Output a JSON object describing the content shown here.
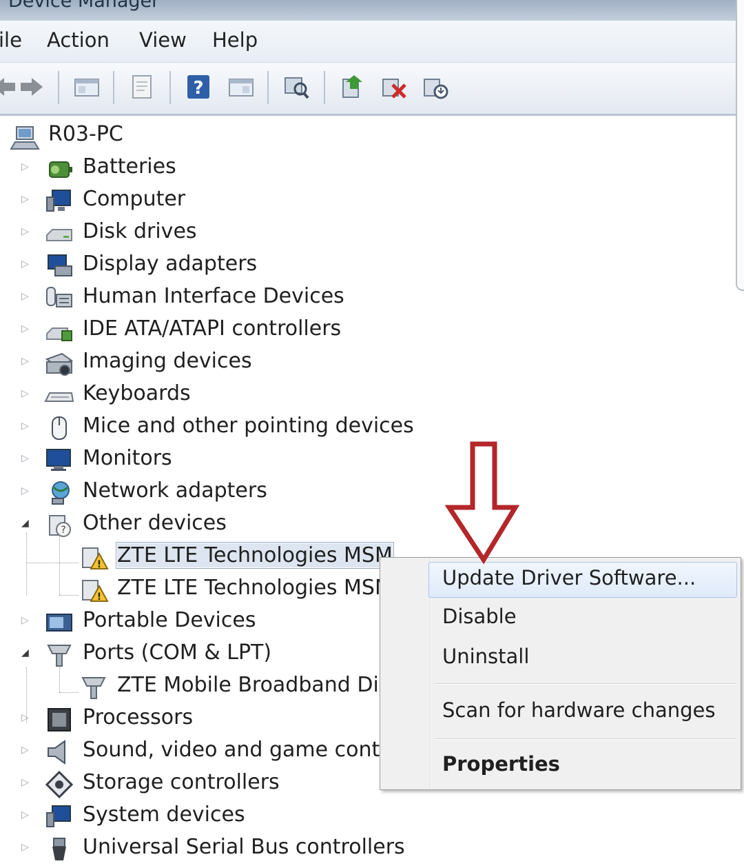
{
  "window": {
    "title": "Device Manager"
  },
  "menubar": {
    "items": [
      "ile",
      "Action",
      "View",
      "Help"
    ]
  },
  "toolbar": {
    "icons": [
      "back-icon",
      "forward-icon",
      "show-hide-console-tree-icon",
      "properties-icon",
      "help-icon",
      "action-pane-icon",
      "scan-hardware-icon",
      "update-driver-icon",
      "uninstall-icon",
      "enable-device-icon"
    ]
  },
  "tree": {
    "root": {
      "label": "R03-PC",
      "icon": "computer-icon"
    },
    "nodes": [
      {
        "label": "Batteries",
        "icon": "battery-icon",
        "expanded": false
      },
      {
        "label": "Computer",
        "icon": "computer-monitor-icon",
        "expanded": false
      },
      {
        "label": "Disk drives",
        "icon": "disk-drive-icon",
        "expanded": false
      },
      {
        "label": "Display adapters",
        "icon": "display-adapter-icon",
        "expanded": false
      },
      {
        "label": "Human Interface Devices",
        "icon": "hid-icon",
        "expanded": false
      },
      {
        "label": "IDE ATA/ATAPI controllers",
        "icon": "ide-controller-icon",
        "expanded": false
      },
      {
        "label": "Imaging devices",
        "icon": "camera-icon",
        "expanded": false
      },
      {
        "label": "Keyboards",
        "icon": "keyboard-icon",
        "expanded": false
      },
      {
        "label": "Mice and other pointing devices",
        "icon": "mouse-icon",
        "expanded": false
      },
      {
        "label": "Monitors",
        "icon": "monitor-icon",
        "expanded": false
      },
      {
        "label": "Network adapters",
        "icon": "network-adapter-icon",
        "expanded": false
      },
      {
        "label": "Other devices",
        "icon": "unknown-device-icon",
        "expanded": true,
        "children": [
          {
            "label": "ZTE LTE Technologies MSM",
            "icon": "warning-device-icon",
            "selected": true
          },
          {
            "label": "ZTE LTE Technologies MSM",
            "icon": "warning-device-icon",
            "selected": false
          }
        ]
      },
      {
        "label": "Portable Devices",
        "icon": "portable-device-icon",
        "expanded": false
      },
      {
        "label": "Ports (COM & LPT)",
        "icon": "port-icon",
        "expanded": true,
        "children": [
          {
            "label": "ZTE Mobile Broadband Diag",
            "icon": "port-icon",
            "selected": false
          }
        ]
      },
      {
        "label": "Processors",
        "icon": "processor-icon",
        "expanded": false
      },
      {
        "label": "Sound, video and game contro",
        "icon": "speaker-icon",
        "expanded": false
      },
      {
        "label": "Storage controllers",
        "icon": "storage-controller-icon",
        "expanded": false
      },
      {
        "label": "System devices",
        "icon": "system-device-icon",
        "expanded": false
      },
      {
        "label": "Universal Serial Bus controllers",
        "icon": "usb-icon",
        "expanded": false
      }
    ]
  },
  "context_menu": {
    "update_driver": "Update Driver Software...",
    "disable": "Disable",
    "uninstall": "Uninstall",
    "scan": "Scan for hardware changes",
    "properties": "Properties"
  },
  "annotation": {
    "arrow_color": "#b3262a"
  }
}
